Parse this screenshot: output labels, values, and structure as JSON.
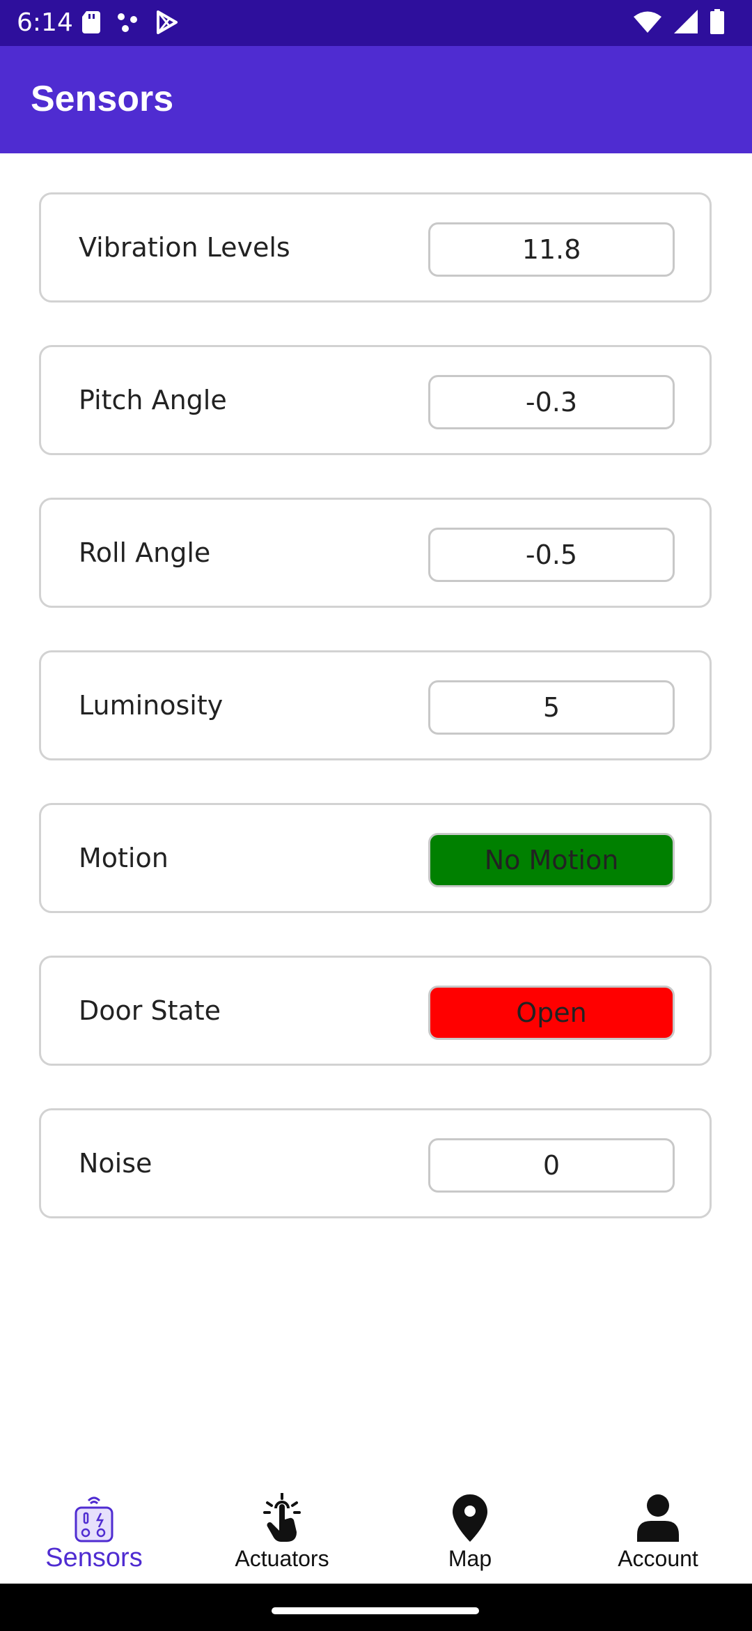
{
  "status_bar": {
    "time": "6:14",
    "icons": [
      "sd-card-icon",
      "dots-icon",
      "play-store-icon",
      "wifi-icon",
      "signal-icon",
      "battery-icon"
    ]
  },
  "app_bar": {
    "title": "Sensors"
  },
  "sensors": [
    {
      "label": "Vibration Levels",
      "value": "11.8",
      "status_color": "#ffffff"
    },
    {
      "label": "Pitch Angle",
      "value": "-0.3",
      "status_color": "#ffffff"
    },
    {
      "label": "Roll Angle",
      "value": "-0.5",
      "status_color": "#ffffff"
    },
    {
      "label": "Luminosity",
      "value": "5",
      "status_color": "#ffffff"
    },
    {
      "label": "Motion",
      "value": "No Motion",
      "status_color": "#008000"
    },
    {
      "label": "Door State",
      "value": "Open",
      "status_color": "#ff0000"
    },
    {
      "label": "Noise",
      "value": "0",
      "status_color": "#ffffff"
    }
  ],
  "bottom_nav": {
    "items": [
      {
        "label": "Sensors",
        "icon": "sensors-icon",
        "active": true
      },
      {
        "label": "Actuators",
        "icon": "touch-hand-icon",
        "active": false
      },
      {
        "label": "Map",
        "icon": "map-pin-icon",
        "active": false
      },
      {
        "label": "Account",
        "icon": "person-icon",
        "active": false
      }
    ]
  },
  "colors": {
    "status_bar": "#2e0f9c",
    "app_bar": "#4f2cd1",
    "accent": "#4f2cd1",
    "motion_ok": "#008000",
    "door_open": "#ff0000"
  }
}
